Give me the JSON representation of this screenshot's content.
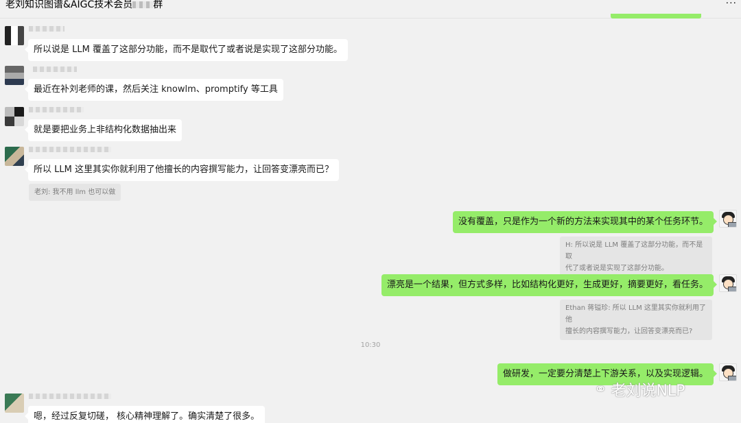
{
  "header": {
    "title": "老刘知识图谱&AIGC技术会员",
    "title_suffix": "群",
    "more_icon": "more-dots-icon",
    "more_glyph": "···"
  },
  "messages": [
    {
      "side": "left",
      "text": "所以说是 LLM 覆盖了这部分功能，而不是取代了或者说是实现了这部分功能。"
    },
    {
      "side": "left",
      "text": "最近在补刘老师的课，然后关注 knowlm、promptify 等工具"
    },
    {
      "side": "left",
      "text": "就是要把业务上非结构化数据抽出来"
    },
    {
      "side": "left",
      "text": "所以 LLM 这里其实你就利用了他擅长的内容撰写能力，让回答变漂亮而已？",
      "quote": "老刘: 我不用 llm 也可以做"
    },
    {
      "side": "right",
      "text": "没有覆盖，只是作为一个新的方法来实现其中的某个任务环节。",
      "quote_line1": "H: 所以说是 LLM 覆盖了这部分功能，而不是取",
      "quote_line2": "代了或者说是实现了这部分功能。"
    },
    {
      "side": "right",
      "text": "漂亮是一个结果，但方式多样，比如结构化更好，生成更好，摘要更好，看任务。",
      "quote_line1": "Ethan 蒋镒珍: 所以 LLM 这里其实你就利用了他",
      "quote_line2": "擅长的内容撰写能力，让回答变漂亮而已?"
    },
    {
      "side": "right",
      "text": "做研发，一定要分清楚上下游关系，以及实现逻辑。"
    },
    {
      "side": "left",
      "text": "嗯，经过反复切磋， 核心精神理解了。确实清楚了很多。"
    }
  ],
  "timestamp": "10:30",
  "watermark": {
    "icon": "wechat-icon",
    "glyph": "⚭",
    "text": "老刘说NLP"
  }
}
